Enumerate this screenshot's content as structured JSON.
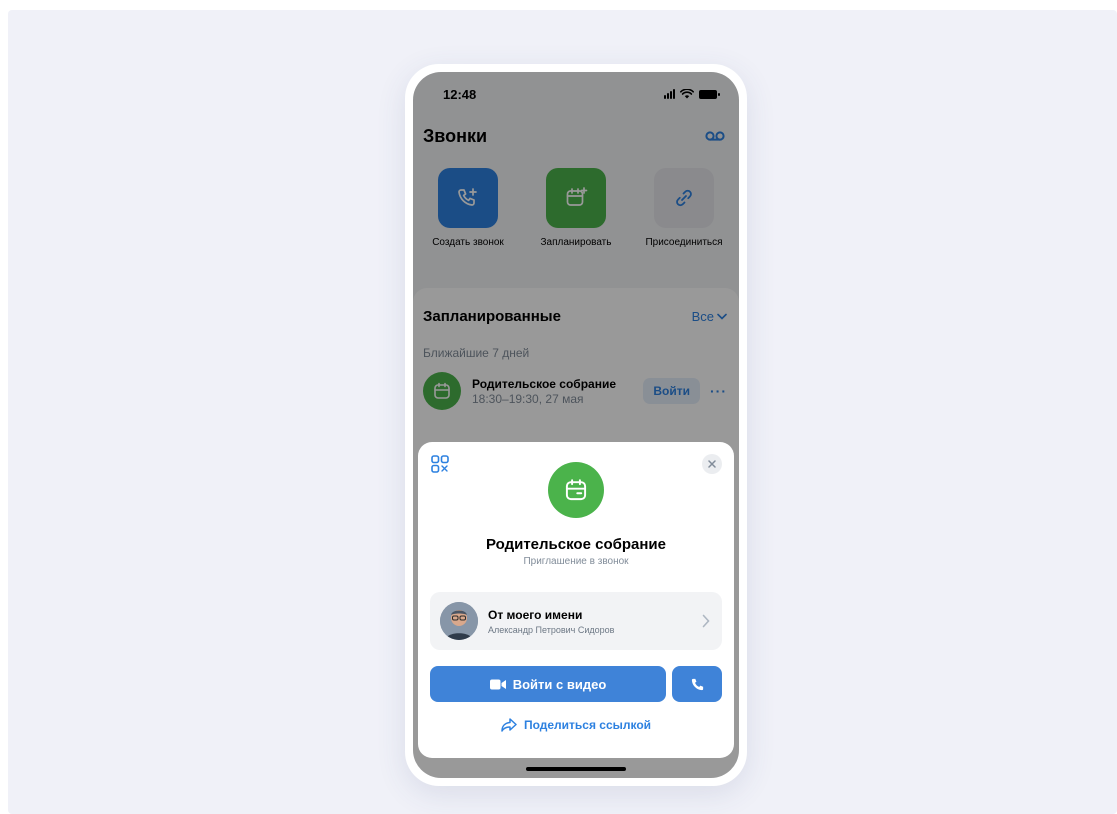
{
  "status_bar": {
    "time": "12:48"
  },
  "calls": {
    "title": "Звонки",
    "voicemail_icon": "voicemail-icon",
    "actions": [
      {
        "label": "Создать звонок",
        "icon": "phone-plus-icon",
        "color": "#2d81e0"
      },
      {
        "label": "Запланировать",
        "icon": "calendar-plus-icon",
        "color": "#4bb34b"
      },
      {
        "label": "Присоединиться",
        "icon": "link-icon",
        "color": "#e6e7eb"
      }
    ]
  },
  "scheduled": {
    "title": "Запланированные",
    "all_label": "Все",
    "section_label": "Ближайшие 7 дней",
    "event": {
      "name": "Родительское собрание",
      "time": "18:30–19:30, 27 мая",
      "join_label": "Войти",
      "more_label": "···"
    }
  },
  "sheet": {
    "title": "Родительское собрание",
    "subtitle": "Приглашение в звонок",
    "from": {
      "title": "От моего имени",
      "name": "Александр Петрович Сидоров"
    },
    "join_video_label": "Войти с видео",
    "share_label": "Поделиться ссылкой"
  },
  "colors": {
    "accent": "#2d81e0",
    "button": "#3f83d8",
    "green": "#4bb34b",
    "page_bg": "#f0f1f8"
  }
}
